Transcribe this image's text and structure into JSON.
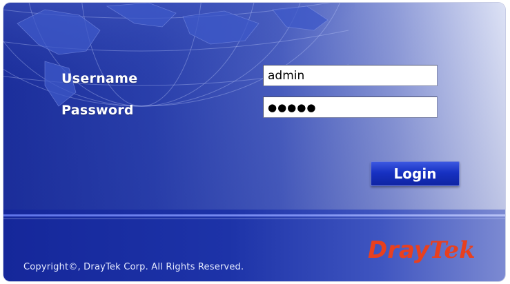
{
  "login_form": {
    "username_label": "Username",
    "password_label": "Password",
    "username_value": "admin",
    "password_value": "●●●●●",
    "login_button_label": "Login"
  },
  "footer": {
    "copyright": "Copyright©, DrayTek Corp. All Rights Reserved.",
    "logo_part_1": "Dray",
    "logo_part_2": "Tek"
  },
  "colors": {
    "panel_blue": "#1c2f9c",
    "button_blue": "#1731c2",
    "logo_red": "#e8401f",
    "label_white": "#ffffff"
  },
  "icons": {
    "background_graphic": "globe-map-graphic"
  }
}
